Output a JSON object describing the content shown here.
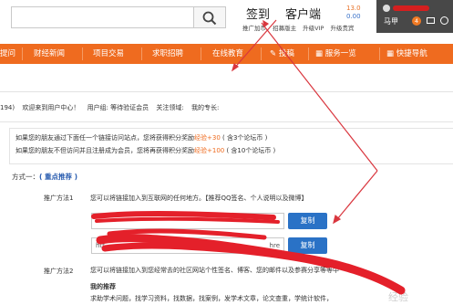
{
  "header": {
    "sign_in": "签到",
    "client": "客户端",
    "coin_a": "13.0",
    "coin_b": "0.00",
    "links": [
      "推广加币",
      "招募版主",
      "升级VIP",
      "升级贵宾"
    ],
    "user_name": "马甲",
    "message_count": "4"
  },
  "nav": {
    "items": [
      "提问",
      "财经新闻",
      "项目交易",
      "求职招聘",
      "在线教育",
      "投稿",
      "服务一览",
      "快捷导航"
    ]
  },
  "info": {
    "prefix": "194)",
    "welcome": "欢迎来到用户中心！",
    "group": "用户组: 等待验证会员",
    "focus": "关注领域:",
    "specialty": "我的专长:"
  },
  "reward": {
    "line1_pre": "如果您的朋友通过下面任一个链接访问站点，您将获得积分奖励",
    "line1_pts": "经验+30",
    "line1_post": "( 含3个论坛币 )",
    "line2_pre": "如果您的朋友不但访问并且注册成为会员，您将再获得积分奖励",
    "line2_pts": "经验+100",
    "line2_post": "( 含10个论坛币 )"
  },
  "method_one": {
    "label": "方式一：",
    "tag": "( 重点推荐 )",
    "promo1_label": "推广方法1",
    "promo1_desc": "您可以将链接加入到互联网的任何地方。【推荐QQ签名、个人说明以及微博】",
    "field1_value": "",
    "field2_value": "htt",
    "field2_suffix": "hre",
    "copy_label": "复制",
    "promo2_label": "推广方法2",
    "promo2_desc": "您可以将链接加入到您经常去的社区网站个性签名、博客、您的邮件以及参赛分享等等中",
    "recommend_title": "我的推荐",
    "recommend_desc": "求助学术问题，找学习资料，找数据，找案例，发学术文章，论文查重，学统计软件，"
  },
  "colors": {
    "nav": "#ef6b1f",
    "button": "#2a72c6",
    "scribble": "#e4202a",
    "arrow": "#d9363e"
  },
  "watermark": "经验"
}
